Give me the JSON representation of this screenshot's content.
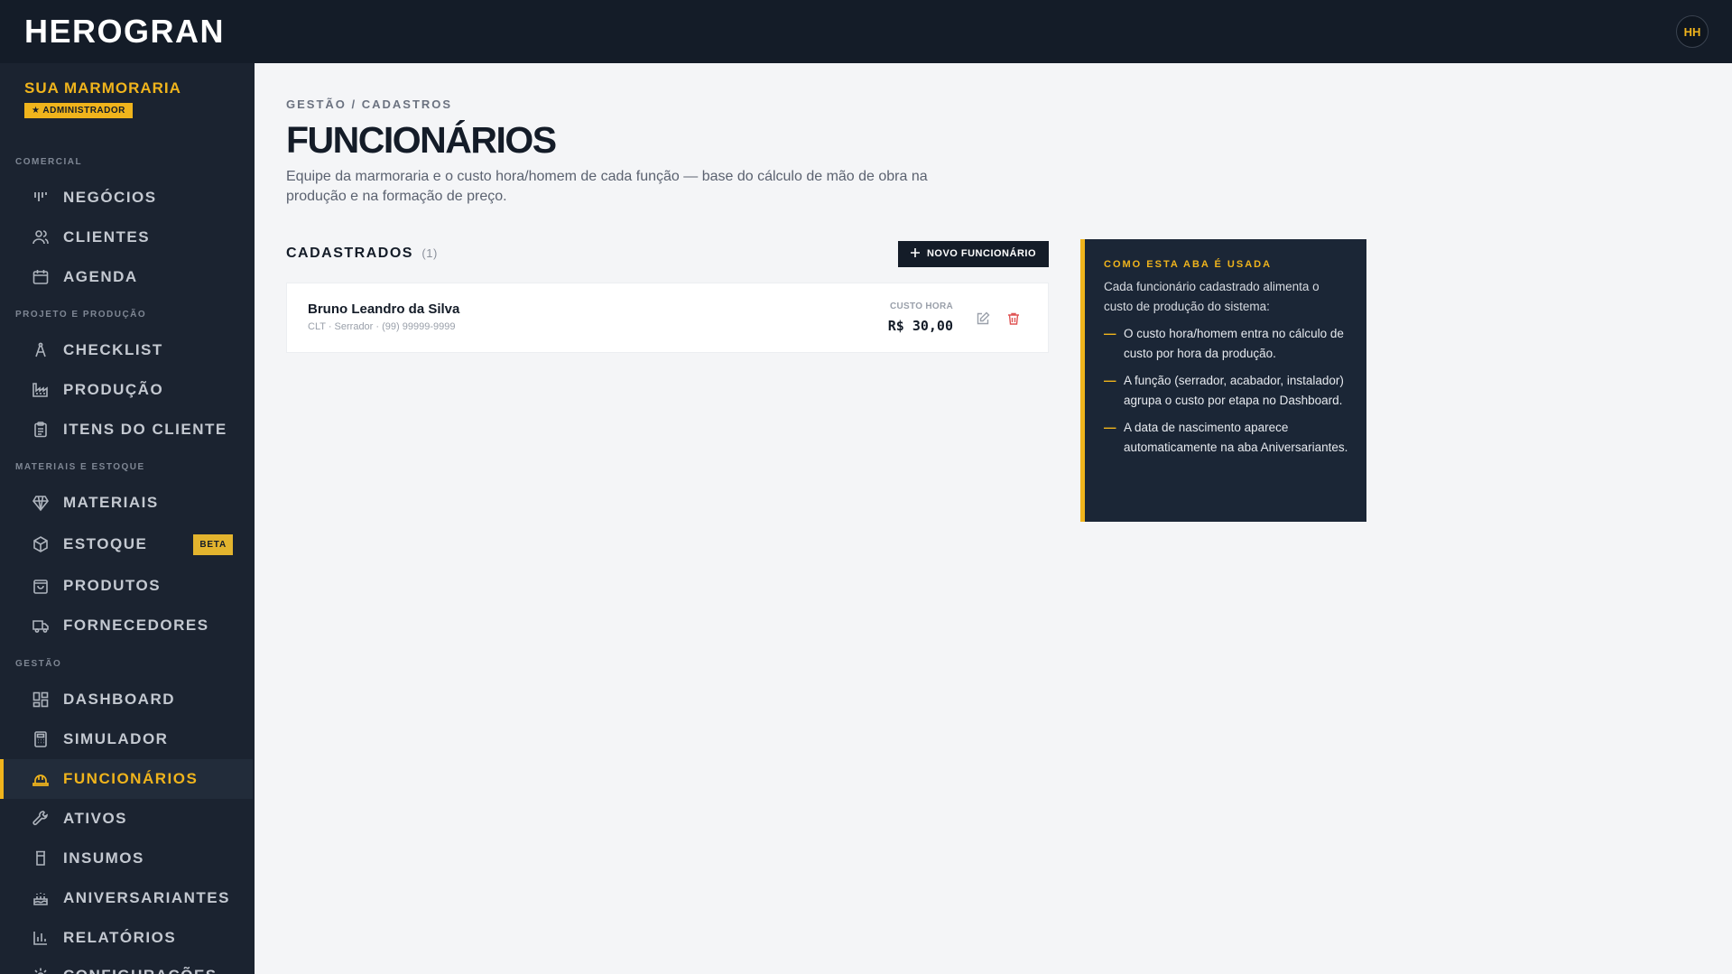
{
  "app": {
    "logo": "HEROGRAN",
    "avatar_initials": "HH"
  },
  "company": {
    "name": "SUA MARMORARIA",
    "role": "★ ADMINISTRADOR"
  },
  "sidebar": {
    "sections": [
      {
        "label": "COMERCIAL"
      },
      {
        "label": "PROJETO E PRODUÇÃO"
      },
      {
        "label": "MATERIAIS E ESTOQUE"
      },
      {
        "label": "GESTÃO"
      }
    ],
    "items": [
      {
        "label": "NEGÓCIOS",
        "icon": "kanban-icon"
      },
      {
        "label": "CLIENTES",
        "icon": "users-icon"
      },
      {
        "label": "AGENDA",
        "icon": "calendar-icon"
      },
      {
        "label": "CHECKLIST",
        "icon": "compass-icon"
      },
      {
        "label": "PRODUÇÃO",
        "icon": "factory-icon"
      },
      {
        "label": "ITENS DO CLIENTE",
        "icon": "clipboard-icon"
      },
      {
        "label": "MATERIAIS",
        "icon": "gem-icon"
      },
      {
        "label": "ESTOQUE",
        "icon": "box-icon",
        "badge": "BETA"
      },
      {
        "label": "PRODUTOS",
        "icon": "shopping-bag-icon"
      },
      {
        "label": "FORNECEDORES",
        "icon": "truck-icon"
      },
      {
        "label": "DASHBOARD",
        "icon": "grid-icon"
      },
      {
        "label": "SIMULADOR",
        "icon": "calculator-icon"
      },
      {
        "label": "FUNCIONÁRIOS",
        "icon": "hard-hat-icon",
        "active": true
      },
      {
        "label": "ATIVOS",
        "icon": "wrench-icon"
      },
      {
        "label": "INSUMOS",
        "icon": "cup-icon"
      },
      {
        "label": "ANIVERSARIANTES",
        "icon": "cake-icon"
      },
      {
        "label": "RELATÓRIOS",
        "icon": "bar-chart-icon"
      },
      {
        "label": "CONFIGURAÇÕES",
        "icon": "settings-icon"
      }
    ]
  },
  "page": {
    "breadcrumb": "GESTÃO / CADASTROS",
    "title": "FUNCIONÁRIOS",
    "description": "Equipe da marmoraria e o custo hora/homem de cada função — base do cálculo de mão de obra na produção e na formação de preço."
  },
  "list": {
    "title": "CADASTRADOS",
    "count": "(1)",
    "new_button": "NOVO FUNCIONÁRIO",
    "employees": [
      {
        "name": "Bruno Leandro da Silva",
        "meta": "CLT · Serrador · (99) 99999-9999",
        "cost_label": "CUSTO HORA",
        "cost_value": "R$ 30,00"
      }
    ]
  },
  "info": {
    "title": "COMO ESTA ABA É USADA",
    "text": "Cada funcionário cadastrado alimenta o custo de produção do sistema:",
    "points": [
      "O custo hora/homem entra no cálculo de custo por hora da produção.",
      "A função (serrador, acabador, instalador) agrupa o custo por etapa no Dashboard.",
      "A data de nascimento aparece automaticamente na aba Aniversariantes."
    ]
  },
  "colors": {
    "accent": "#f0b41c",
    "sidebar_bg": "#1b2330",
    "topbar_bg": "#141c28",
    "danger": "#e05555"
  }
}
